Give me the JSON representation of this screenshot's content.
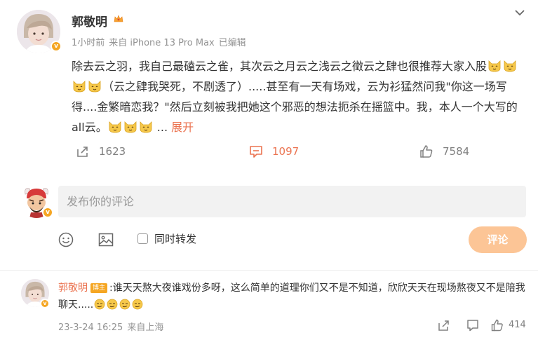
{
  "post": {
    "author": "郭敬明",
    "meta": {
      "time": "1小时前",
      "source": "来自 iPhone 13 Pro Max",
      "edited": "已编辑"
    },
    "text_parts": {
      "p1": "除去云之羽，我自己最磕云之雀，其次云之月云之浅云之徵云之肆也很推荐大家入股",
      "p2": "（云之肆我哭死，不剧透了）.....甚至有一天有场戏，云为衫猛然问我\"你这一场写得....金繁暗恋我？\"然后立刻被我把她这个邪恶的想法扼杀在摇篮中。我，本人一个大写的all云。",
      "ellipsis": "...",
      "expand": "展开"
    },
    "actions": {
      "repost_count": "1623",
      "comment_count": "1097",
      "like_count": "7584"
    },
    "icons": [
      "chevron-down-icon",
      "crown-icon",
      "verified-badge-icon",
      "repost-icon",
      "comment-icon",
      "like-icon",
      "cat-emoji-icon"
    ]
  },
  "compose": {
    "placeholder": "发布你的评论",
    "repost_label": "同时转发",
    "submit_label": "评论",
    "icons": [
      "emoji-icon",
      "image-icon"
    ]
  },
  "comment": {
    "author": "郭敬明",
    "tag": "博主",
    "text": ":谁天天熬大夜谁戏份多呀，这么简单的道理你们又不是不知道，欣欣天天在现场熬夜又不是陪我聊天.....",
    "date": "23-3-24 16:25",
    "location": "来自上海",
    "like_count": "414",
    "icons": [
      "share-icon",
      "comment-icon",
      "like-icon",
      "smirk-emoji-icon"
    ]
  },
  "colors": {
    "accent": "#eb7350",
    "badge": "#f5a623",
    "button_disabled": "#fcc596",
    "meta_text": "#939393"
  }
}
